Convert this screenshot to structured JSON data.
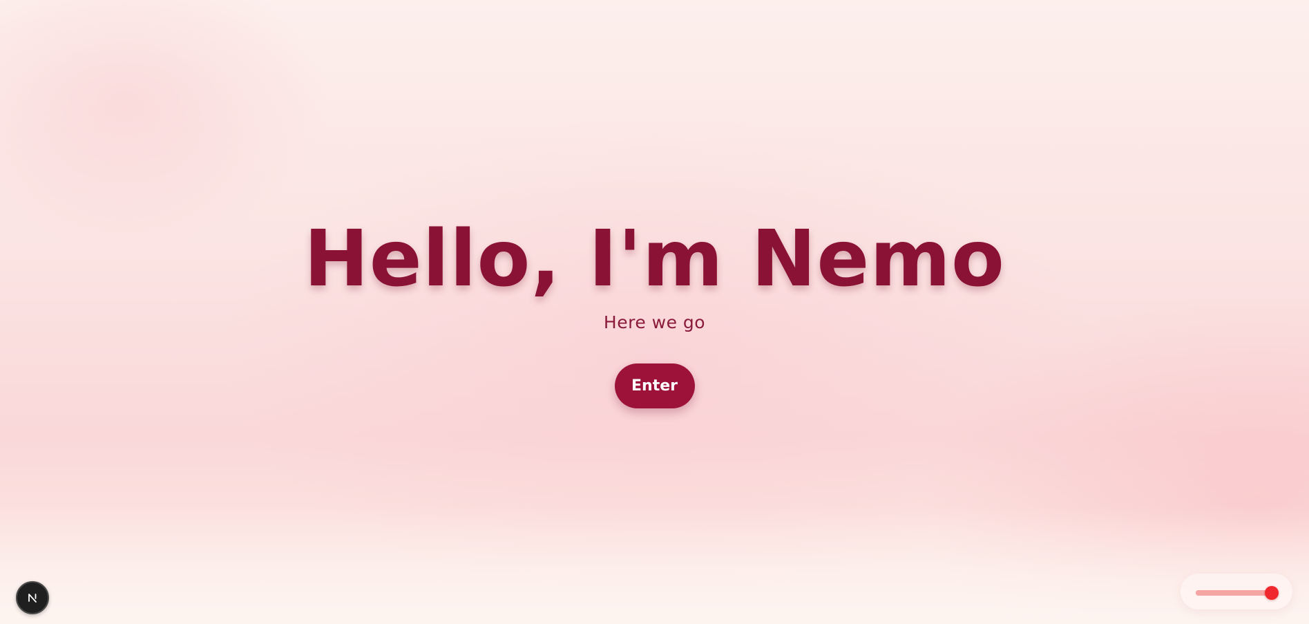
{
  "hero": {
    "title": "Hello, I'm Nemo",
    "subtitle": "Here we go",
    "enter_label": "Enter"
  },
  "badge": {
    "letter": "N",
    "icon": "nextjs-logo-icon"
  },
  "volume": {
    "icon": "volume-slider",
    "level": 0.92
  },
  "colors": {
    "accent": "#8a1235",
    "button": "#9c1239",
    "slider_thumb": "#f0282e",
    "slider_track": "#f8b8b8"
  }
}
